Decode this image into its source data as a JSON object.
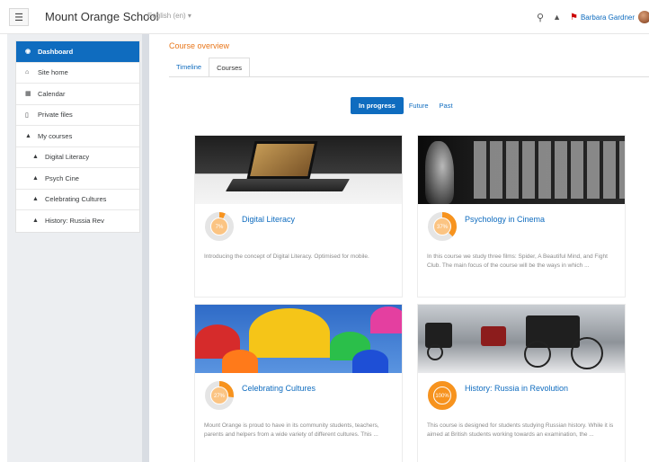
{
  "navbar": {
    "site_name": "Mount Orange School",
    "language": "English (en) ▾",
    "user_name": "Barbara Gardner",
    "icons": [
      "menu-icon",
      "search-icon",
      "bell-icon",
      "flag-icon"
    ]
  },
  "drawer": {
    "items": [
      {
        "label": "Dashboard",
        "icon": "dashboard-icon",
        "active": true
      },
      {
        "label": "Site home",
        "icon": "home-icon"
      },
      {
        "label": "Calendar",
        "icon": "calendar-icon"
      },
      {
        "label": "Private files",
        "icon": "file-icon"
      },
      {
        "label": "My courses",
        "icon": "graduation-cap-icon"
      },
      {
        "label": "Digital Literacy",
        "icon": "graduation-cap-icon",
        "sub": true
      },
      {
        "label": "Psych Cine",
        "icon": "graduation-cap-icon",
        "sub": true
      },
      {
        "label": "Celebrating Cultures",
        "icon": "graduation-cap-icon",
        "sub": true
      },
      {
        "label": "History: Russia Rev",
        "icon": "graduation-cap-icon",
        "sub": true
      }
    ]
  },
  "main": {
    "section_title": "Course overview",
    "tabs": [
      {
        "label": "Timeline",
        "active": false
      },
      {
        "label": "Courses",
        "active": true
      }
    ],
    "filters": [
      {
        "label": "In progress",
        "active": true
      },
      {
        "label": "Future",
        "active": false
      },
      {
        "label": "Past",
        "active": false
      }
    ]
  },
  "courses": [
    {
      "title": "Digital Literacy",
      "progress": 7,
      "progress_label": "7%",
      "summary": "Introducing the concept of Digital Literacy. Optimised for mobile."
    },
    {
      "title": "Psychology in Cinema",
      "progress": 37,
      "progress_label": "37%",
      "summary": "In this course we study three films: Spider, A Beautiful Mind, and Fight Club. The main focus of the course will be the ways in which ..."
    },
    {
      "title": "Celebrating Cultures",
      "progress": 27,
      "progress_label": "27%",
      "summary": "Mount Orange is proud to have in its community students, teachers, parents and helpers from a wide variety of different cultures. This ..."
    },
    {
      "title": "History: Russia in Revolution",
      "progress": 100,
      "progress_label": "100%",
      "summary": "This course is designed for students studying Russian history. While it is aimed at British students working towards an examination, the ..."
    }
  ],
  "colors": {
    "accent": "#0f6cbf",
    "progress": "#f7931e",
    "progress_track": "#e5e5e5",
    "section_title": "#e8761a"
  }
}
